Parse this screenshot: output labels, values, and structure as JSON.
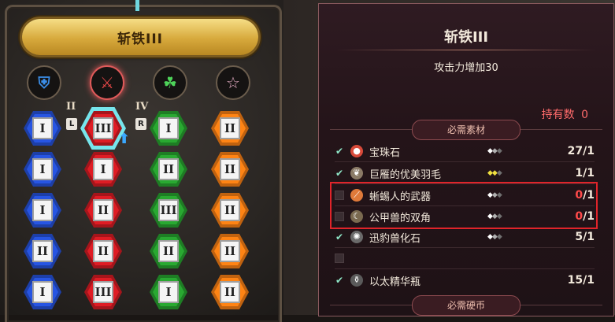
{
  "skill_tree": {
    "title": "斩铁III",
    "columns": [
      {
        "icon": "shield-icon",
        "color": "#3b8ee8"
      },
      {
        "icon": "sword-icon",
        "color": "#e04646"
      },
      {
        "icon": "leaf-icon",
        "color": "#4ed45a"
      },
      {
        "icon": "star-icon",
        "color": "#e9b0c8"
      }
    ],
    "roman_left": "II",
    "roman_right": "IV",
    "tag_left": "L",
    "tag_right": "R",
    "rows": [
      [
        "I",
        "III",
        "I",
        "II"
      ],
      [
        "I",
        "I",
        "II",
        "II"
      ],
      [
        "I",
        "II",
        "III",
        "II"
      ],
      [
        "II",
        "II",
        "II",
        "II"
      ],
      [
        "I",
        "III",
        "I",
        "II"
      ]
    ]
  },
  "detail": {
    "title": "斩铁III",
    "effect": "攻击力增加30",
    "owned_label": "持有数",
    "owned_value": "0",
    "materials_header": "必需素材",
    "coins_header": "必需硬币",
    "materials": [
      {
        "name": "宝珠石",
        "have": "27",
        "need": "/1",
        "checked": true,
        "icon": "orb-stone-icon",
        "icon_color": "#d84a3a",
        "rarity_colors": [
          "#ffffff",
          "#b0b0b0",
          "#707070"
        ]
      },
      {
        "name": "巨雁的优美羽毛",
        "have": "1",
        "need": "/1",
        "checked": true,
        "icon": "feather-icon",
        "icon_color": "#d8c8b0",
        "rarity_colors": [
          "#f0e040",
          "#f0e040",
          "#707070"
        ]
      },
      {
        "name": "蜥蜴人的武器",
        "have": "0",
        "need": "/1",
        "checked": false,
        "icon": "claw-weapon-icon",
        "icon_color": "#e07a3a",
        "rarity_colors": [
          "#ffffff",
          "#b0b0b0",
          "#707070"
        ]
      },
      {
        "name": "公甲兽的双角",
        "have": "0",
        "need": "/1",
        "checked": false,
        "icon": "horn-icon",
        "icon_color": "#d9c39a",
        "rarity_colors": [
          "#ffffff",
          "#b0b0b0",
          "#707070"
        ]
      },
      {
        "name": "迅豹兽化石",
        "have": "5",
        "need": "/1",
        "checked": true,
        "icon": "fossil-icon",
        "icon_color": "#a0a0a0",
        "rarity_colors": [
          "#ffffff",
          "#b0b0b0",
          "#707070"
        ]
      },
      {
        "name": "",
        "have": "",
        "need": "",
        "checked": false,
        "icon": "",
        "icon_color": "",
        "rarity_colors": []
      },
      {
        "name": "以太精华瓶",
        "have": "15",
        "need": "/1",
        "checked": true,
        "icon": "ether-bottle-icon",
        "icon_color": "#d0d0d0",
        "rarity_colors": []
      }
    ]
  }
}
